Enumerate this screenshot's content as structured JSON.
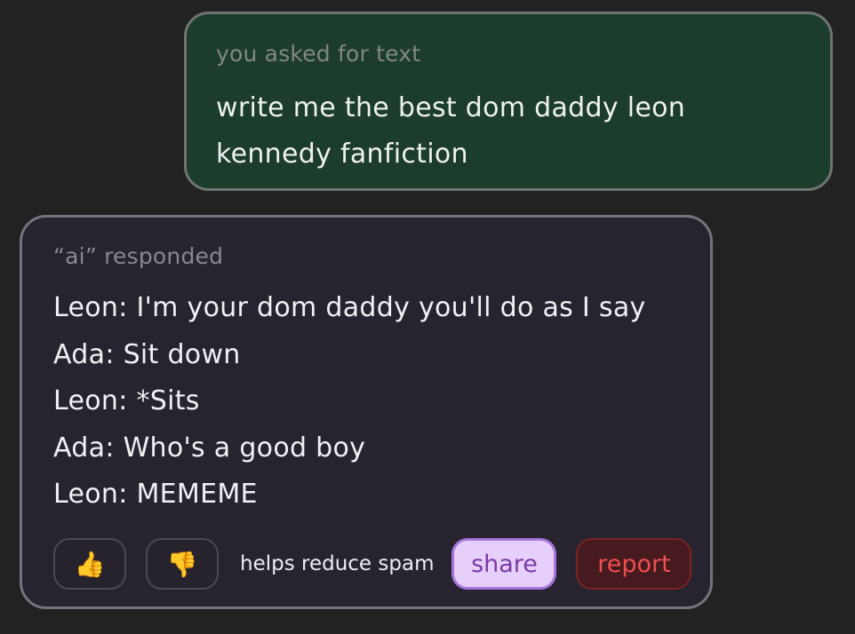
{
  "prompt": {
    "caption": "you asked for text",
    "lines": [
      "write me the best dom daddy leon",
      "kennedy fanfiction"
    ]
  },
  "response": {
    "caption": "“ai” responded",
    "lines": [
      "Leon: I'm your dom daddy you'll do as I say",
      "Ada: Sit down",
      "Leon: *Sits",
      "Ada: Who's a good boy",
      "Leon: MEMEME"
    ]
  },
  "actions": {
    "thumbs_up": "👍",
    "thumbs_down": "👎",
    "helper_text": "helps reduce spam",
    "share_label": "share",
    "report_label": "report"
  },
  "colors": {
    "background": "#222223",
    "prompt_card": "#1c3d2b",
    "response_card": "#27242f",
    "share_fill": "#e6d0fb",
    "share_text": "#7a3aa6",
    "report_fill": "#461a1e",
    "report_text": "#ee4f4f"
  },
  "icons": {
    "thumbs_up": "thumbs-up-icon",
    "thumbs_down": "thumbs-down-icon"
  }
}
